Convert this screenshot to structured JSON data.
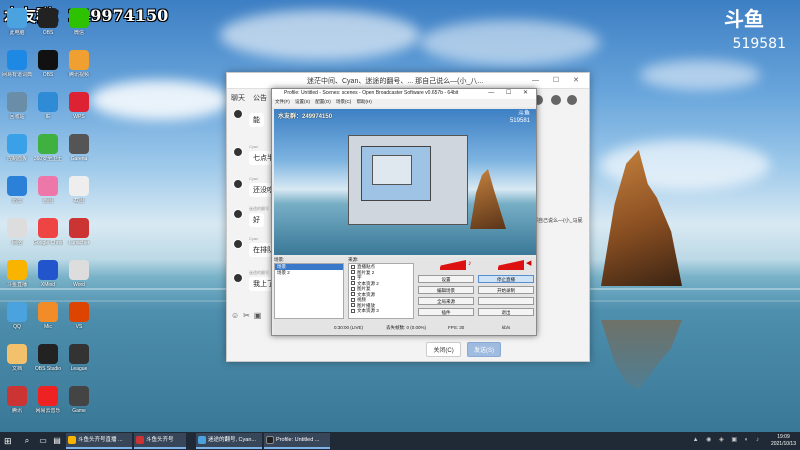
{
  "overlay": {
    "qq_group_label": "水友群：",
    "qq_group_number": "249974150",
    "platform_logo": "斗鱼",
    "room_id": "519581"
  },
  "desktop_icons": [
    {
      "label": "此电脑",
      "icon": "computer-icon",
      "color": "#4aa3df"
    },
    {
      "label": "OBS",
      "icon": "obs-icon",
      "color": "#222"
    },
    {
      "label": "微信",
      "icon": "wechat-icon",
      "color": "#2dc100"
    },
    {
      "label": "网易有道词典",
      "icon": "app-icon",
      "color": "#1e88e5"
    },
    {
      "label": "OBS",
      "icon": "obs-icon",
      "color": "#111"
    },
    {
      "label": "腾讯视频",
      "icon": "video-icon",
      "color": "#f0a030"
    },
    {
      "label": "回收站",
      "icon": "recycle-icon",
      "color": "#6b8ea8"
    },
    {
      "label": "IE",
      "icon": "ie-icon",
      "color": "#2f8bd6"
    },
    {
      "label": "WPS",
      "icon": "wps-icon",
      "color": "#d23"
    },
    {
      "label": "控制面板",
      "icon": "settings-icon",
      "color": "#3aa0e8"
    },
    {
      "label": "360安全卫士",
      "icon": "shield-icon",
      "color": "#40b040"
    },
    {
      "label": "Garena",
      "icon": "game-icon",
      "color": "#555"
    },
    {
      "label": "迅雷",
      "icon": "download-icon",
      "color": "#2b80d8"
    },
    {
      "label": "画图",
      "icon": "paint-icon",
      "color": "#e7a"
    },
    {
      "label": "截图",
      "icon": "image-icon",
      "color": "#eee"
    },
    {
      "label": "网络",
      "icon": "network-icon",
      "color": "#ddd"
    },
    {
      "label": "Google Chrome",
      "icon": "chrome-icon",
      "color": "#e44"
    },
    {
      "label": "Lunacher",
      "icon": "launcher-icon",
      "color": "#c33"
    },
    {
      "label": "斗鱼直播",
      "icon": "douyu-icon",
      "color": "#f9b400"
    },
    {
      "label": "XMind",
      "icon": "xmind-icon",
      "color": "#2255cc"
    },
    {
      "label": "Word",
      "icon": "doc-icon",
      "color": "#ddd"
    },
    {
      "label": "QQ",
      "icon": "qq-icon",
      "color": "#4aa3df"
    },
    {
      "label": "Mic",
      "icon": "mic-icon",
      "color": "#f28c28"
    },
    {
      "label": "VS",
      "icon": "app-icon",
      "color": "#d40"
    },
    {
      "label": "文档",
      "icon": "file-icon",
      "color": "#f3c16b"
    },
    {
      "label": "OBS Studio",
      "icon": "obs-icon",
      "color": "#222"
    },
    {
      "label": "League",
      "icon": "league-icon",
      "color": "#333"
    },
    {
      "label": "腾讯",
      "icon": "game-icon",
      "color": "#c33"
    },
    {
      "label": "网易云音乐",
      "icon": "music-icon",
      "color": "#e22"
    },
    {
      "label": "Game",
      "icon": "game-icon",
      "color": "#444"
    }
  ],
  "chat_window": {
    "title": "迷茫中间、Cyan、迷途的翻号、... 那自己说么—(小_八...",
    "tabs": [
      "聊天",
      "公告"
    ],
    "messages": [
      {
        "sender": "",
        "text": "能"
      },
      {
        "sender": "Cyan",
        "text": "七点半"
      },
      {
        "sender": "Cyan",
        "text": "还没吃"
      },
      {
        "sender": "迷途的翻号",
        "text": "好"
      },
      {
        "sender": "Cyan",
        "text": "在排队"
      },
      {
        "sender": "迷途的翻号",
        "text": "我上了"
      }
    ],
    "side_text": "那自己说么—(小_马屁",
    "side_count": "5",
    "footer_buttons": {
      "close": "关闭(C)",
      "send": "发送(S)"
    }
  },
  "obs": {
    "title": "Profile: Untitled - Scenes: scenes - Open Broadcaster Software v0.657b - 64bit",
    "menu": [
      "文件(F)",
      "设置(S)",
      "配置(O)",
      "场景(C)",
      "帮助(H)"
    ],
    "preview_overlay": {
      "qq": "水友群：249974150",
      "logo": "斗鱼",
      "room": "519581"
    },
    "scenes_label": "场景:",
    "sources_label": "来源:",
    "scenes": [
      "场景",
      "场景 2"
    ],
    "sources": [
      "直播贴点",
      "图片复 2",
      "字",
      "文本资源 2",
      "图片复",
      "文本资源",
      "视频",
      "图片播放",
      "文本资源 3"
    ],
    "buttons": [
      {
        "label": "设置",
        "active": false
      },
      {
        "label": "停止直播",
        "active": true
      },
      {
        "label": "编辑场景",
        "active": false
      },
      {
        "label": "开始录制",
        "active": false
      },
      {
        "label": "全局来源",
        "active": false
      },
      {
        "label": "",
        "active": false
      },
      {
        "label": "插件",
        "active": false
      },
      {
        "label": "退出",
        "active": false
      }
    ],
    "status": {
      "time": "0:30:00 (LIVE)",
      "dropped": "丢失帧数: 0 (0.00%)",
      "fps": "FPS: 30",
      "bitrate": "kb/s"
    }
  },
  "taskbar": {
    "tasks": [
      {
        "label": "斗鱼头齐号直播 ...",
        "color": "#f9b400"
      },
      {
        "label": "斗鱼头齐号",
        "color": "#c33"
      },
      {
        "label": "迷途的翻号, Cyan...",
        "color": "#4aa3df"
      },
      {
        "label": "Profile: Untitled ...",
        "color": "#222"
      }
    ],
    "time": "19:09",
    "date": "2021/10/13"
  }
}
